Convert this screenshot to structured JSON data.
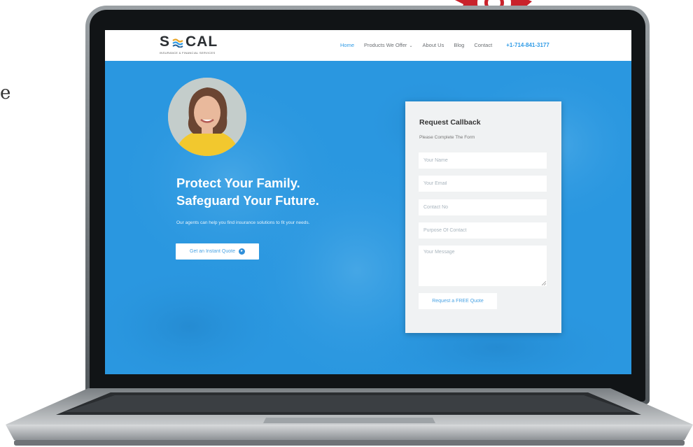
{
  "edge": {
    "left_fragment": "e"
  },
  "brand": {
    "logo_left": "S",
    "logo_right": "CAL",
    "logo_tagline": "INSURANCE & FINANCIAL SERVICES",
    "accent_color": "#2f9be6",
    "hero_color": "#2a97e0"
  },
  "nav": {
    "items": [
      {
        "label": "Home",
        "active": true
      },
      {
        "label": "Products We Offer",
        "has_dropdown": true
      },
      {
        "label": "About Us"
      },
      {
        "label": "Blog"
      },
      {
        "label": "Contact"
      }
    ],
    "phone": "+1-714-841-3177"
  },
  "hero": {
    "headline_line1": "Protect Your Family.",
    "headline_line2": "Safeguard Your Future.",
    "subtext": "Our agents can help you find insurance solutions to fit your needs.",
    "cta_label": "Get an Instant Quote",
    "cta_icon": "arrow-circle-right-icon"
  },
  "form": {
    "title": "Request Callback",
    "subtitle": "Please Complete The Form",
    "name_placeholder": "Your Name",
    "email_placeholder": "Your Email",
    "contact_placeholder": "Contact No",
    "purpose_placeholder": "Purpose Of Contact",
    "message_placeholder": "Your Message",
    "submit_label": "Request a FREE Quote"
  }
}
